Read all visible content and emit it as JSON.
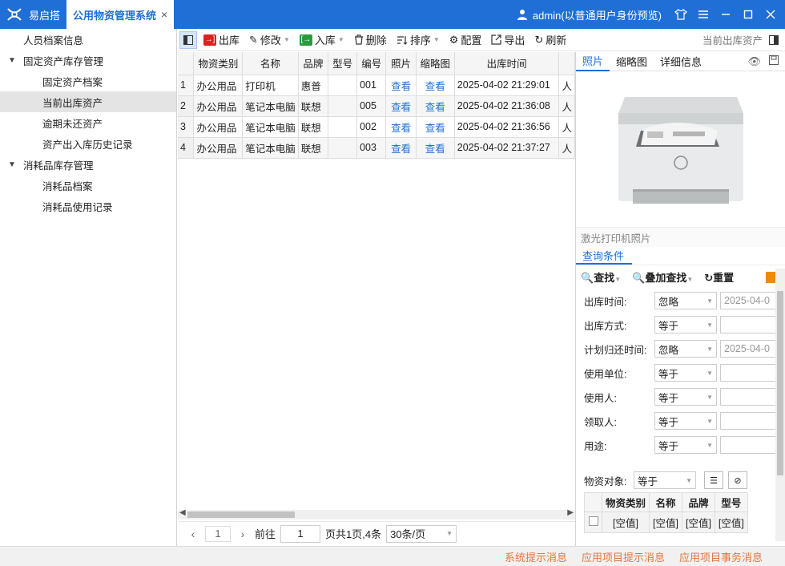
{
  "titlebar": {
    "app_name": "易启搭",
    "active_tab": "公用物资管理系统",
    "close_glyph": "×",
    "user": "admin(以普通用户身份预览)"
  },
  "sidebar": {
    "items": [
      {
        "label": "人员档案信息"
      },
      {
        "label": "固定资产库存管理"
      },
      {
        "label": "固定资产档案"
      },
      {
        "label": "当前出库资产"
      },
      {
        "label": "逾期未还资产"
      },
      {
        "label": "资产出入库历史记录"
      },
      {
        "label": "消耗品库存管理"
      },
      {
        "label": "消耗品档案"
      },
      {
        "label": "消耗品使用记录"
      }
    ]
  },
  "toolbar": {
    "out_label": "出库",
    "edit_label": "修改",
    "in_label": "入库",
    "delete_label": "删除",
    "sort_label": "排序",
    "config_label": "配置",
    "export_label": "导出",
    "refresh_label": "刷新",
    "current_view": "当前出库资产"
  },
  "grid": {
    "columns": [
      "物资类别",
      "名称",
      "品牌",
      "型号",
      "编号",
      "照片",
      "缩略图",
      "出库时间"
    ],
    "rows": [
      {
        "n": "1",
        "cat": "办公用品",
        "name": "打印机",
        "brand": "惠普",
        "model": "",
        "code": "001",
        "photo": "查看",
        "thumb": "查看",
        "time": "2025-04-02 21:29:01"
      },
      {
        "n": "2",
        "cat": "办公用品",
        "name": "笔记本电脑",
        "brand": "联想",
        "model": "",
        "code": "005",
        "photo": "查看",
        "thumb": "查看",
        "time": "2025-04-02 21:36:08"
      },
      {
        "n": "3",
        "cat": "办公用品",
        "name": "笔记本电脑",
        "brand": "联想",
        "model": "",
        "code": "002",
        "photo": "查看",
        "thumb": "查看",
        "time": "2025-04-02 21:36:56"
      },
      {
        "n": "4",
        "cat": "办公用品",
        "name": "笔记本电脑",
        "brand": "联想",
        "model": "",
        "code": "003",
        "photo": "查看",
        "thumb": "查看",
        "time": "2025-04-02 21:37:27"
      }
    ]
  },
  "pager": {
    "current_page": "1",
    "goto_label": "前往",
    "goto_value": "1",
    "summary": "页共1页,4条",
    "page_size": "30条/页"
  },
  "right_panel": {
    "tabs": [
      "照片",
      "缩略图",
      "详细信息"
    ],
    "photo_caption": "激光打印机照片",
    "query_tab": "查询条件",
    "query_find": "查找",
    "query_add_find": "叠加查找",
    "query_reset": "重置",
    "conditions": [
      {
        "label": "出库时间:",
        "op": "忽略",
        "value": "2025-04-0"
      },
      {
        "label": "出库方式:",
        "op": "等于",
        "value": ""
      },
      {
        "label": "计划归还时间:",
        "op": "忽略",
        "value": "2025-04-0"
      },
      {
        "label": "使用单位:",
        "op": "等于",
        "value": ""
      },
      {
        "label": "使用人:",
        "op": "等于",
        "value": ""
      },
      {
        "label": "领取人:",
        "op": "等于",
        "value": ""
      },
      {
        "label": "用途:",
        "op": "等于",
        "value": ""
      }
    ],
    "object_label": "物资对象:",
    "object_op": "等于",
    "sub_columns": [
      "物资类别",
      "名称",
      "品牌",
      "型号"
    ],
    "sub_row": [
      "[空值]",
      "[空值]",
      "[空值]",
      "[空值]"
    ]
  },
  "statusbar": {
    "sys_msg": "系统提示消息",
    "app_msg": "应用项目提示消息",
    "task_msg": "应用项目事务消息"
  },
  "colors": {
    "brand": "#1f6fd6",
    "status_text": "#e07840"
  }
}
